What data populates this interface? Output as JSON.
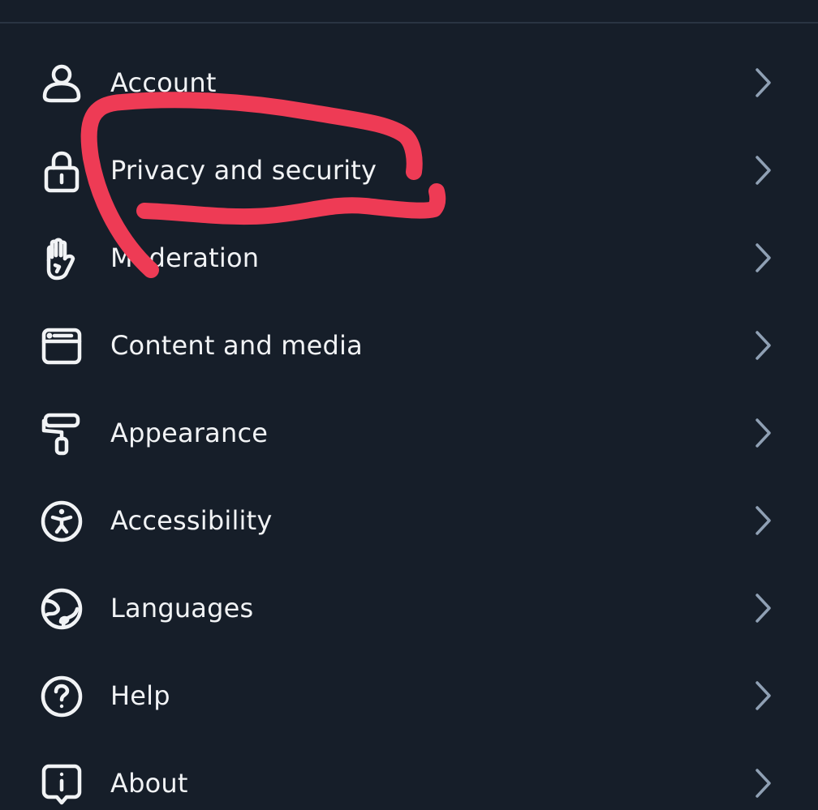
{
  "settings": {
    "items": [
      {
        "label": "Account",
        "icon": "person-icon"
      },
      {
        "label": "Privacy and security",
        "icon": "lock-icon"
      },
      {
        "label": "Moderation",
        "icon": "raised-hand-icon"
      },
      {
        "label": "Content and media",
        "icon": "browser-window-icon"
      },
      {
        "label": "Appearance",
        "icon": "paint-roller-icon"
      },
      {
        "label": "Accessibility",
        "icon": "accessibility-person-icon"
      },
      {
        "label": "Languages",
        "icon": "globe-icon"
      },
      {
        "label": "Help",
        "icon": "question-circle-icon"
      },
      {
        "label": "About",
        "icon": "info-speech-bubble-icon"
      }
    ]
  },
  "colors": {
    "background": "#161e29",
    "text": "#f1f3f5",
    "chevron": "#8fa0b4",
    "divider": "#2a3442",
    "annotation_stroke": "#ee3b55"
  }
}
